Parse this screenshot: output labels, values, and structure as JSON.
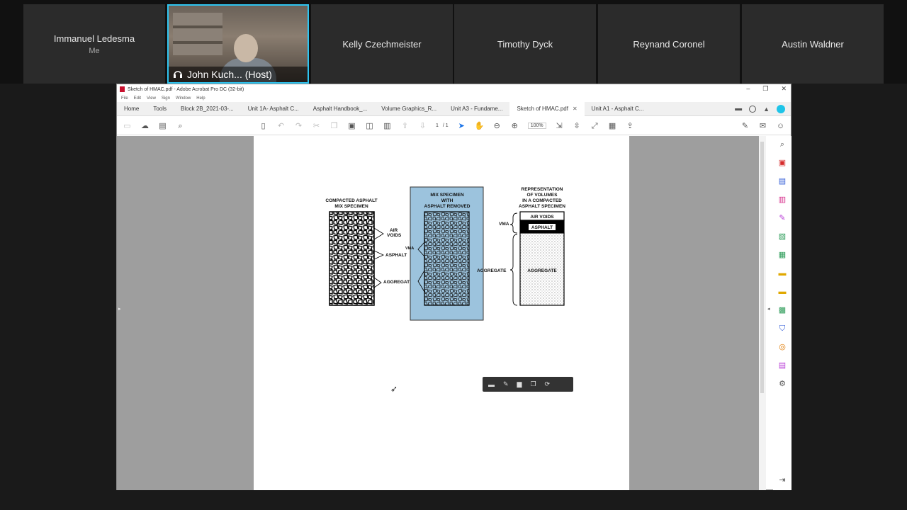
{
  "participants": [
    {
      "name": "Immanuel Ledesma",
      "sub": "Me"
    },
    {
      "name": "John Kuch...  (Host)",
      "active": true
    },
    {
      "name": "Kelly Czechmeister"
    },
    {
      "name": "Timothy Dyck"
    },
    {
      "name": "Reynand Coronel"
    },
    {
      "name": "Austin Waldner"
    }
  ],
  "window": {
    "title": "Sketch of HMAC.pdf - Adobe Acrobat Pro DC (32-bit)",
    "menu": [
      "File",
      "Edit",
      "View",
      "Sign",
      "Window",
      "Help"
    ],
    "tabs": [
      {
        "label": "Home"
      },
      {
        "label": "Tools"
      },
      {
        "label": "Block 2B_2021-03-..."
      },
      {
        "label": "Unit 1A- Asphalt C..."
      },
      {
        "label": "Asphalt Handbook_..."
      },
      {
        "label": "Volume Graphics_R..."
      },
      {
        "label": "Unit A3 - Fundame..."
      },
      {
        "label": "Sketch of HMAC.pdf",
        "active": true
      },
      {
        "label": "Unit A1 - Asphalt C..."
      }
    ],
    "page_current": "1",
    "page_total": "/ 1",
    "zoom": "100%"
  },
  "figure": {
    "left_title_1": "COMPACTED ASPHALT",
    "left_title_2": "MIX SPECIMEN",
    "mid_title_1": "MIX SPECIMEN",
    "mid_title_2": "WITH",
    "mid_title_3": "ASPHALT REMOVED",
    "right_title_1": "REPRESENTATION",
    "right_title_2": "OF VOLUMES",
    "right_title_3": "IN A COMPACTED",
    "right_title_4": "ASPHALT SPECIMEN",
    "label_air": "AIR",
    "label_voids": "VOIDS",
    "label_asphalt": "ASPHALT",
    "label_aggregate": "AGGREGATE",
    "label_vma": "VMA",
    "label_vma2": "VMA",
    "label_aggregate2": "AGGREGATE",
    "box_air_voids": "AIR VOIDS",
    "box_asphalt": "ASPHALT",
    "box_aggregate": "AGGREGATE",
    "highlight_color": "#9cc3dd"
  }
}
